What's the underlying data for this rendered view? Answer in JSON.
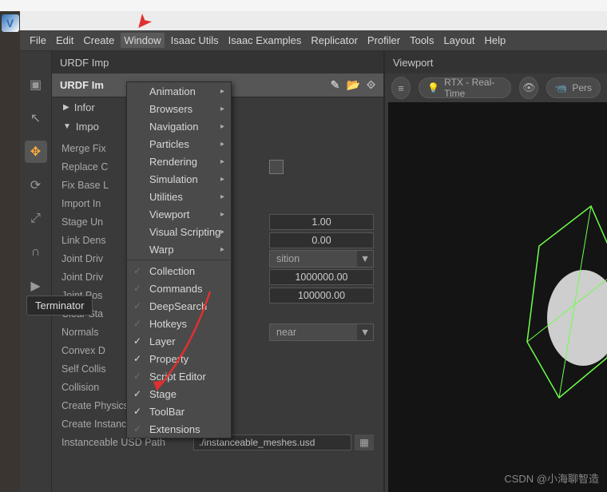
{
  "menubar": [
    "File",
    "Edit",
    "Create",
    "Window",
    "Isaac Utils",
    "Isaac Examples",
    "Replicator",
    "Profiler",
    "Tools",
    "Layout",
    "Help"
  ],
  "menubar_hl_index": 3,
  "panel": {
    "tab": "URDF Imp",
    "section": "URDF Im",
    "info": "Infor",
    "import_head": "Impo",
    "rows": {
      "merge": "Merge Fix",
      "replace": "Replace C",
      "fixbase": "Fix Base L",
      "importin": "Import In",
      "stageun": "Stage Un",
      "linkdens": "Link Dens",
      "jointdriv": "Joint Driv",
      "jointpos": "Joint Pos",
      "clearst": "Clear Sta",
      "normals": "Normals",
      "convexd": "Convex D",
      "selfcoll": "Self Collis",
      "collision": "Collision",
      "createphys": "Create Physics Scene",
      "createinst": "Create Instanceable Asset",
      "instpath_lbl": "Instanceable USD Path"
    },
    "vals": {
      "stage": "1.00",
      "link": "0.00",
      "drive_sel": "sition",
      "val1": "1000000.00",
      "val2": "100000.00",
      "normals_sel": "near",
      "instpath": "./instanceable_meshes.usd"
    }
  },
  "dropdown": {
    "sub": [
      "Animation",
      "Browsers",
      "Navigation",
      "Particles",
      "Rendering",
      "Simulation",
      "Utilities",
      "Viewport",
      "Visual Scripting",
      "Warp"
    ],
    "toggles": [
      {
        "label": "Collection",
        "on": false
      },
      {
        "label": "Commands",
        "on": false
      },
      {
        "label": "DeepSearch",
        "on": false
      },
      {
        "label": "Hotkeys",
        "on": false
      },
      {
        "label": "Layer",
        "on": true
      },
      {
        "label": "Property",
        "on": true
      },
      {
        "label": "Script Editor",
        "on": false
      },
      {
        "label": "Stage",
        "on": true
      },
      {
        "label": "ToolBar",
        "on": true
      },
      {
        "label": "Extensions",
        "on": false
      }
    ]
  },
  "viewport": {
    "tab": "Viewport",
    "render": "RTX - Real-Time",
    "cam": "Pers"
  },
  "tooltip": "Terminator",
  "watermark": "CSDN @小海聊智造"
}
